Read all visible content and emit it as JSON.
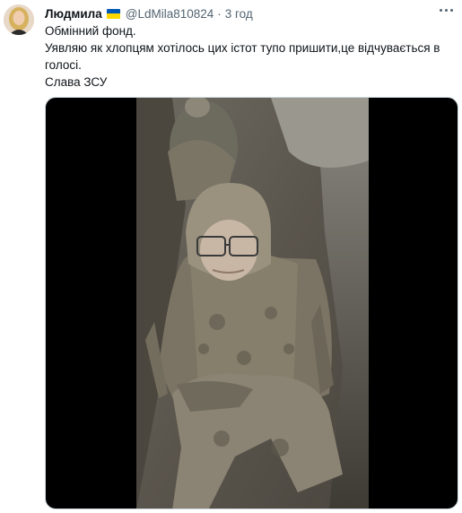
{
  "author": {
    "name": "Людмила",
    "handle": "@LdMila810824",
    "separator": "·",
    "time": "3 год",
    "flag_colors": [
      "#0057b7",
      "#ffd700"
    ]
  },
  "tweet": {
    "lines": [
      "Обмінний фонд.",
      "Уявляю як хлопцям хотілось цих істот тупо пришити,це відчувається в",
      "голосі.",
      "Слава ЗСУ"
    ]
  },
  "icons": {
    "more": "more-horizontal-icon",
    "verified_flag": "ukraine-flag-icon"
  },
  "colors": {
    "text_primary": "#0f1419",
    "text_secondary": "#536471",
    "media_background": "#000000"
  }
}
